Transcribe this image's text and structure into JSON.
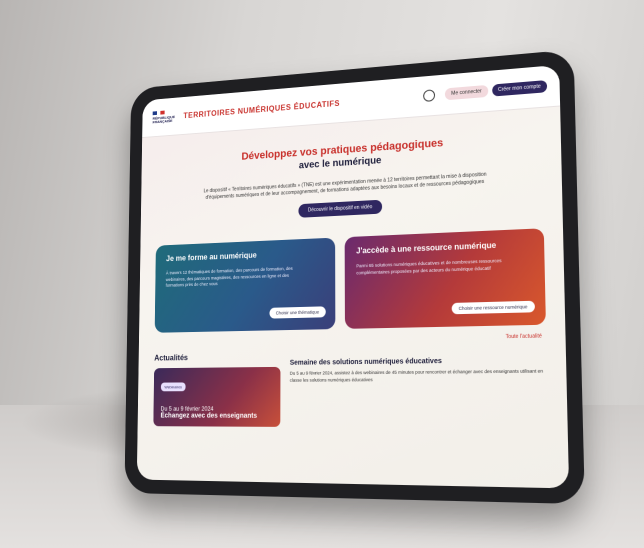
{
  "header": {
    "logo_text": "RÉPUBLIQUE FRANÇAISE",
    "site_title": "TERRITOIRES NUMÉRIQUES ÉDUCATIFS",
    "buttons": [
      "Me connecter",
      "Créer mon compte"
    ]
  },
  "hero": {
    "title_line1": "Développez vos pratiques pédagogiques",
    "title_line2": "avec le numérique",
    "description": "Le dispositif « Territoires numériques éducatifs » (TNE) est une expérimentation menée à 12 territoires permettant la mise à disposition d'équipements numériques et de leur accompagnement, de formations adaptées aux besoins locaux et de ressources pédagogiques",
    "cta_label": "Découvrir le dispositif en vidéo"
  },
  "cards": [
    {
      "title": "Je me forme au numérique",
      "text": "À travers 12 thématiques de formation, des parcours de formation, des webinaires, des parcours magistères, des ressources en ligne et des formations près de chez vous",
      "button": "Choisir une thématique"
    },
    {
      "title": "J'accède à une ressource numérique",
      "text": "Parmi 65 solutions numériques éducatives et de nombreuses ressources complémentaires proposées par des acteurs du numérique éducatif",
      "button": "Choisir une ressource numérique"
    }
  ],
  "see_all": "Toute l'actualité",
  "news": {
    "section_title": "Actualités",
    "tag": "Webinaires",
    "date": "Du 5 au 9 février 2024",
    "headline": "Échangez avec des enseignants",
    "article_title": "Semaine des solutions numériques éducatives",
    "article_text": "Du 5 au 9 février 2024, assistez à des webinaires de 45 minutes pour rencontrer et échanger avec des enseignants utilisant en classe les solutions numériques éducatives"
  }
}
